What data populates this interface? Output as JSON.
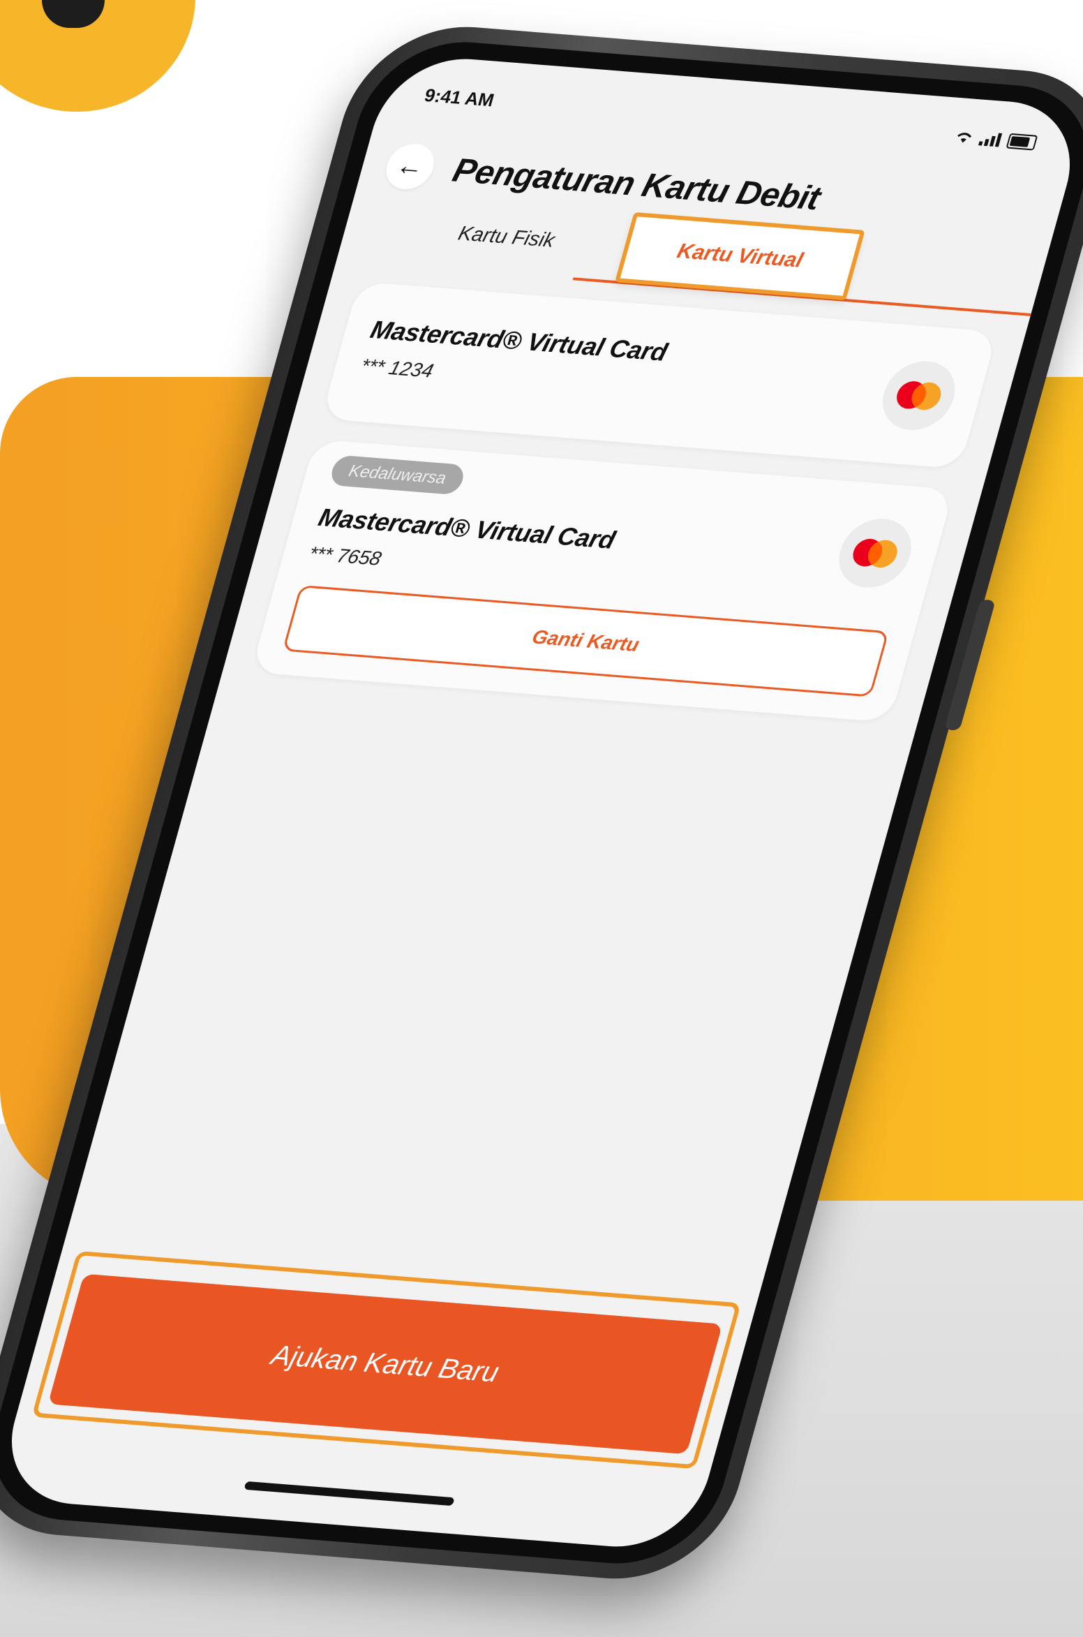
{
  "status": {
    "time": "9:41 AM",
    "signal_glyph": "•••"
  },
  "header": {
    "back_glyph": "←",
    "title": "Pengaturan Kartu Debit"
  },
  "tabs": [
    {
      "label": "Kartu Fisik",
      "active": false
    },
    {
      "label": "Kartu Virtual",
      "active": true
    }
  ],
  "cards": [
    {
      "name": "Mastercard® Virtual Card",
      "number": "*** 1234",
      "badge": "",
      "icon": "mastercard-logo"
    },
    {
      "name": "Mastercard® Virtual Card",
      "number": "*** 7658",
      "badge": "Kedaluwarsa",
      "action_label": "Ganti Kartu",
      "icon": "mastercard-logo"
    }
  ],
  "cta": {
    "label": "Ajukan Kartu Baru"
  },
  "colors": {
    "accent": "#ea5524",
    "highlight": "#f19a2c",
    "background_panel": "#f4a023",
    "screen": "#f2f2f2"
  }
}
